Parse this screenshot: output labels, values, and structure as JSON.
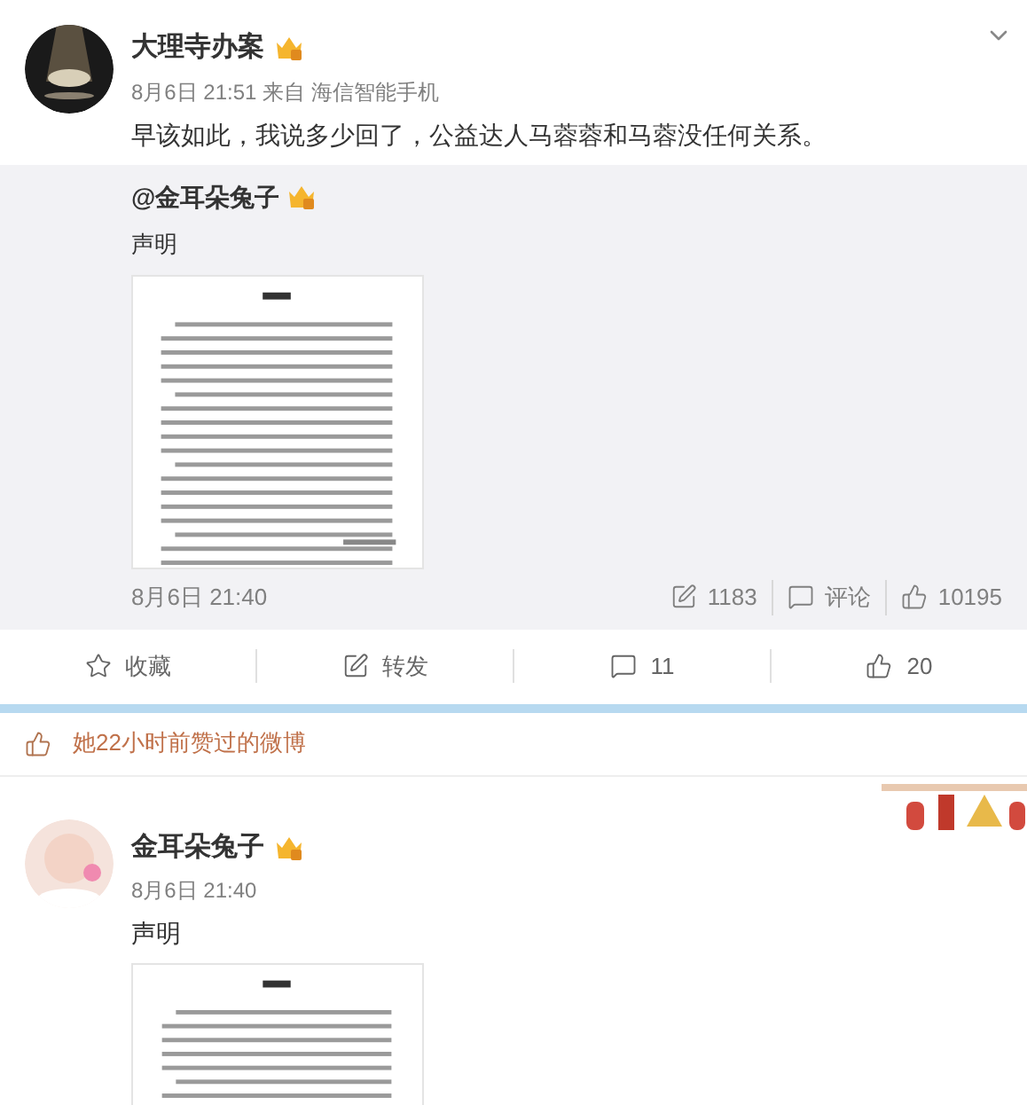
{
  "post": {
    "author": "大理寺办案",
    "meta": "8月6日 21:51 来自 海信智能手机",
    "text": "早该如此，我说多少回了，公益达人马蓉蓉和马蓉没任何关系。",
    "repost": {
      "author": "@金耳朵兔子",
      "text": "声明",
      "time": "8月6日 21:40",
      "stats": [
        {
          "kind": "forward",
          "label": "1183"
        },
        {
          "kind": "comment",
          "label": "评论"
        },
        {
          "kind": "like",
          "label": "10195"
        }
      ]
    },
    "actions": [
      {
        "kind": "favorite",
        "label": "收藏"
      },
      {
        "kind": "forward",
        "label": "转发"
      },
      {
        "kind": "comment",
        "label": "11"
      },
      {
        "kind": "like",
        "label": "20"
      }
    ]
  },
  "liked_notice": "她22小时前赞过的微博",
  "post2": {
    "author": "金耳朵兔子",
    "meta": "8月6日 21:40",
    "text": "声明"
  }
}
